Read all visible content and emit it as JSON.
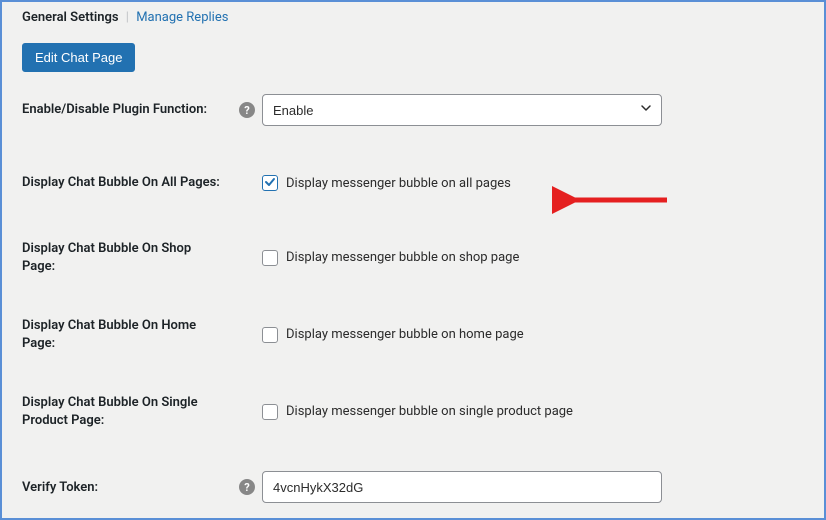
{
  "tabs": {
    "active": "General Settings",
    "other": "Manage Replies"
  },
  "buttons": {
    "edit_chat_page": "Edit Chat Page"
  },
  "fields": {
    "enable": {
      "label": "Enable/Disable Plugin Function:",
      "value": "Enable"
    },
    "all_pages": {
      "label": "Display Chat Bubble On All Pages:",
      "checkbox_text": "Display messenger bubble on all pages",
      "checked": true
    },
    "shop_page": {
      "label": "Display Chat Bubble On Shop Page:",
      "checkbox_text": "Display messenger bubble on shop page",
      "checked": false
    },
    "home_page": {
      "label": "Display Chat Bubble On Home Page:",
      "checkbox_text": "Display messenger bubble on home page",
      "checked": false
    },
    "single_product": {
      "label": "Display Chat Bubble On Single Product Page:",
      "checkbox_text": "Display messenger bubble on single product page",
      "checked": false
    },
    "verify_token": {
      "label": "Verify Token:",
      "value": "4vcnHykX32dG"
    }
  },
  "colors": {
    "accent": "#2271b1",
    "border": "#5a8fd6",
    "arrow": "#e52020"
  }
}
